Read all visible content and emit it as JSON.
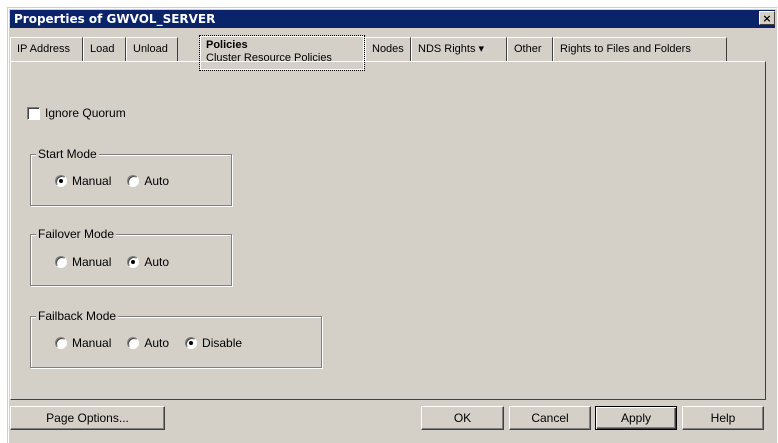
{
  "window": {
    "title": "Properties of GWVOL_SERVER",
    "close_glyph": "×"
  },
  "tabs": [
    {
      "label": "IP Address"
    },
    {
      "label": "Load"
    },
    {
      "label": "Unload"
    },
    {
      "label": "Policies",
      "sublabel": "Cluster Resource Policies",
      "active": true
    },
    {
      "label": "Nodes"
    },
    {
      "label": "NDS Rights ▾"
    },
    {
      "label": "Other"
    },
    {
      "label": "Rights to Files and Folders"
    }
  ],
  "policies": {
    "ignore_quorum": {
      "label": "Ignore Quorum",
      "checked": false
    },
    "start_mode": {
      "label": "Start Mode",
      "options": [
        {
          "label": "Manual",
          "selected": true
        },
        {
          "label": "Auto",
          "selected": false
        }
      ]
    },
    "failover_mode": {
      "label": "Failover Mode",
      "options": [
        {
          "label": "Manual",
          "selected": false
        },
        {
          "label": "Auto",
          "selected": true
        }
      ]
    },
    "failback_mode": {
      "label": "Failback Mode",
      "options": [
        {
          "label": "Manual",
          "selected": false
        },
        {
          "label": "Auto",
          "selected": false
        },
        {
          "label": "Disable",
          "selected": true
        }
      ]
    }
  },
  "buttons": {
    "page_options": "Page Options...",
    "ok": "OK",
    "cancel": "Cancel",
    "apply": "Apply",
    "help": "Help"
  }
}
